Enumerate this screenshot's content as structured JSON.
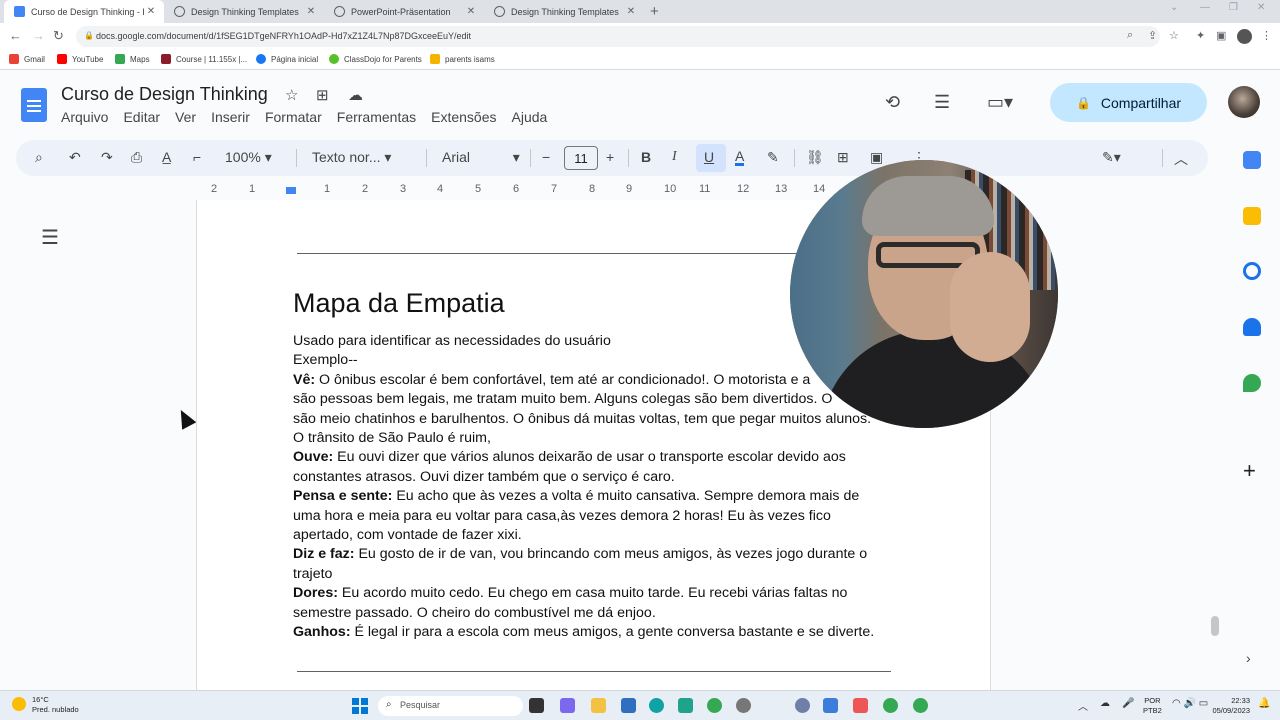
{
  "browser": {
    "tabs": [
      {
        "title": "Curso de Design Thinking - Doc",
        "active": true,
        "icon_color": "#4285f4"
      },
      {
        "title": "Design Thinking Templates",
        "active": false,
        "icon_color": "#5f6368"
      },
      {
        "title": "PowerPoint-Präsentation",
        "active": false,
        "icon_color": "#5f6368"
      },
      {
        "title": "Design Thinking Templates",
        "active": false,
        "icon_color": "#5f6368"
      }
    ],
    "url": "docs.google.com/document/d/1fSEG1DTgeNFRYh1OAdP-Hd7xZ1Z4L7Np87DGxceeEuY/edit",
    "bookmarks": [
      {
        "label": "Gmail",
        "color": "#ea4335"
      },
      {
        "label": "YouTube",
        "color": "#ff0000"
      },
      {
        "label": "Maps",
        "color": "#34a853"
      },
      {
        "label": "Course | 11.155x |...",
        "color": "#8a1c2b"
      },
      {
        "label": "Página inicial",
        "color": "#1877f2"
      },
      {
        "label": "ClassDojo for Parents",
        "color": "#56c02b"
      },
      {
        "label": "parents isams",
        "color": "#f4b400"
      }
    ]
  },
  "docs": {
    "title": "Curso de Design Thinking",
    "menu": [
      "Arquivo",
      "Editar",
      "Ver",
      "Inserir",
      "Formatar",
      "Ferramentas",
      "Extensões",
      "Ajuda"
    ],
    "share_label": "Compartilhar",
    "toolbar": {
      "zoom": "100%",
      "style": "Texto nor...",
      "font": "Arial",
      "font_size": "11"
    },
    "ruler": [
      "2",
      "1",
      "1",
      "2",
      "3",
      "4",
      "5",
      "6",
      "7",
      "8",
      "9",
      "10",
      "11",
      "12",
      "13",
      "14"
    ]
  },
  "document": {
    "heading": "Mapa da Empatia",
    "lines": [
      {
        "bold": "",
        "text": "Usado para identificar as necessidades do usuário"
      },
      {
        "bold": "",
        "text": "Exemplo--"
      },
      {
        "bold": "Vê:",
        "text": " O ônibus escolar é bem confortável, tem até ar condicionado!. O motorista e a"
      },
      {
        "bold": "",
        "text": "são pessoas bem legais, me tratam muito bem. Alguns colegas são bem divertidos. O"
      },
      {
        "bold": "",
        "text": "são meio chatinhos e barulhentos. O ônibus dá muitas voltas, tem que pegar muitos alunos."
      },
      {
        "bold": "",
        "text": "O trânsito de São Paulo é ruim,"
      },
      {
        "bold": "Ouve:",
        "text": " Eu ouvi dizer que vários alunos deixarão de usar o transporte escolar devido aos"
      },
      {
        "bold": "",
        "text": "constantes atrasos. Ouvi dizer também que o serviço é caro."
      },
      {
        "bold": "Pensa e sente:",
        "text": " Eu acho que às vezes a volta é muito cansativa. Sempre demora mais de"
      },
      {
        "bold": "",
        "text": "uma hora e meia para eu voltar para casa,às vezes demora 2 horas! Eu às vezes fico"
      },
      {
        "bold": "",
        "text": "apertado, com vontade de fazer xixi."
      },
      {
        "bold": "Diz e faz:",
        "text": " Eu gosto de ir de van, vou brincando com meus amigos, às vezes jogo durante o"
      },
      {
        "bold": "",
        "text": "trajeto"
      },
      {
        "bold": "Dores:",
        "text": " Eu acordo muito cedo. Eu chego em casa muito tarde. Eu recebi várias faltas no"
      },
      {
        "bold": "",
        "text": "semestre passado. O cheiro do combustível me dá enjoo."
      },
      {
        "bold": "Ganhos:",
        "text": " É legal ir para a escola com meus amigos, a gente conversa bastante e se diverte."
      }
    ]
  },
  "taskbar": {
    "weather_temp": "16°C",
    "weather_desc": "Pred. nublado",
    "search_placeholder": "Pesquisar",
    "lang": "POR",
    "lang2": "PTB2",
    "time": "22:33",
    "date": "05/09/2023"
  }
}
